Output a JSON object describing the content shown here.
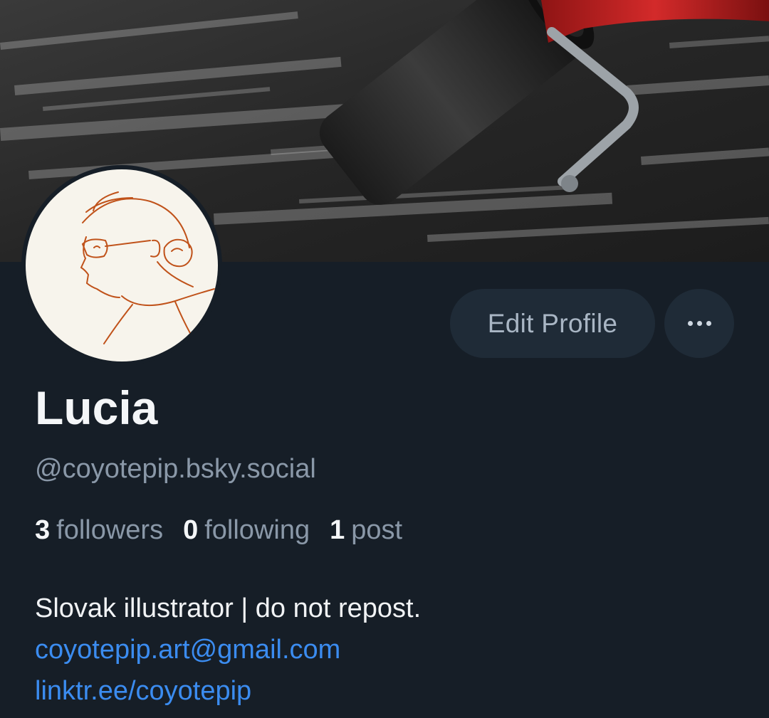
{
  "profile": {
    "display_name": "Lucia",
    "handle": "@coyotepip.bsky.social",
    "stats": [
      {
        "count": "3",
        "label": "followers"
      },
      {
        "count": "0",
        "label": "following"
      },
      {
        "count": "1",
        "label": "post"
      }
    ],
    "bio": {
      "text": "Slovak illustrator | do not repost.",
      "links": [
        "coyotepip.art@gmail.com",
        "linktr.ee/coyotepip"
      ]
    }
  },
  "actions": {
    "edit_label": "Edit Profile",
    "more_icon": "ellipsis-icon"
  },
  "colors": {
    "background": "#161e27",
    "button_bg": "#1f2b37",
    "link": "#3b8cf0",
    "muted": "#8a98a8",
    "avatar_ink": "#c0521a"
  }
}
